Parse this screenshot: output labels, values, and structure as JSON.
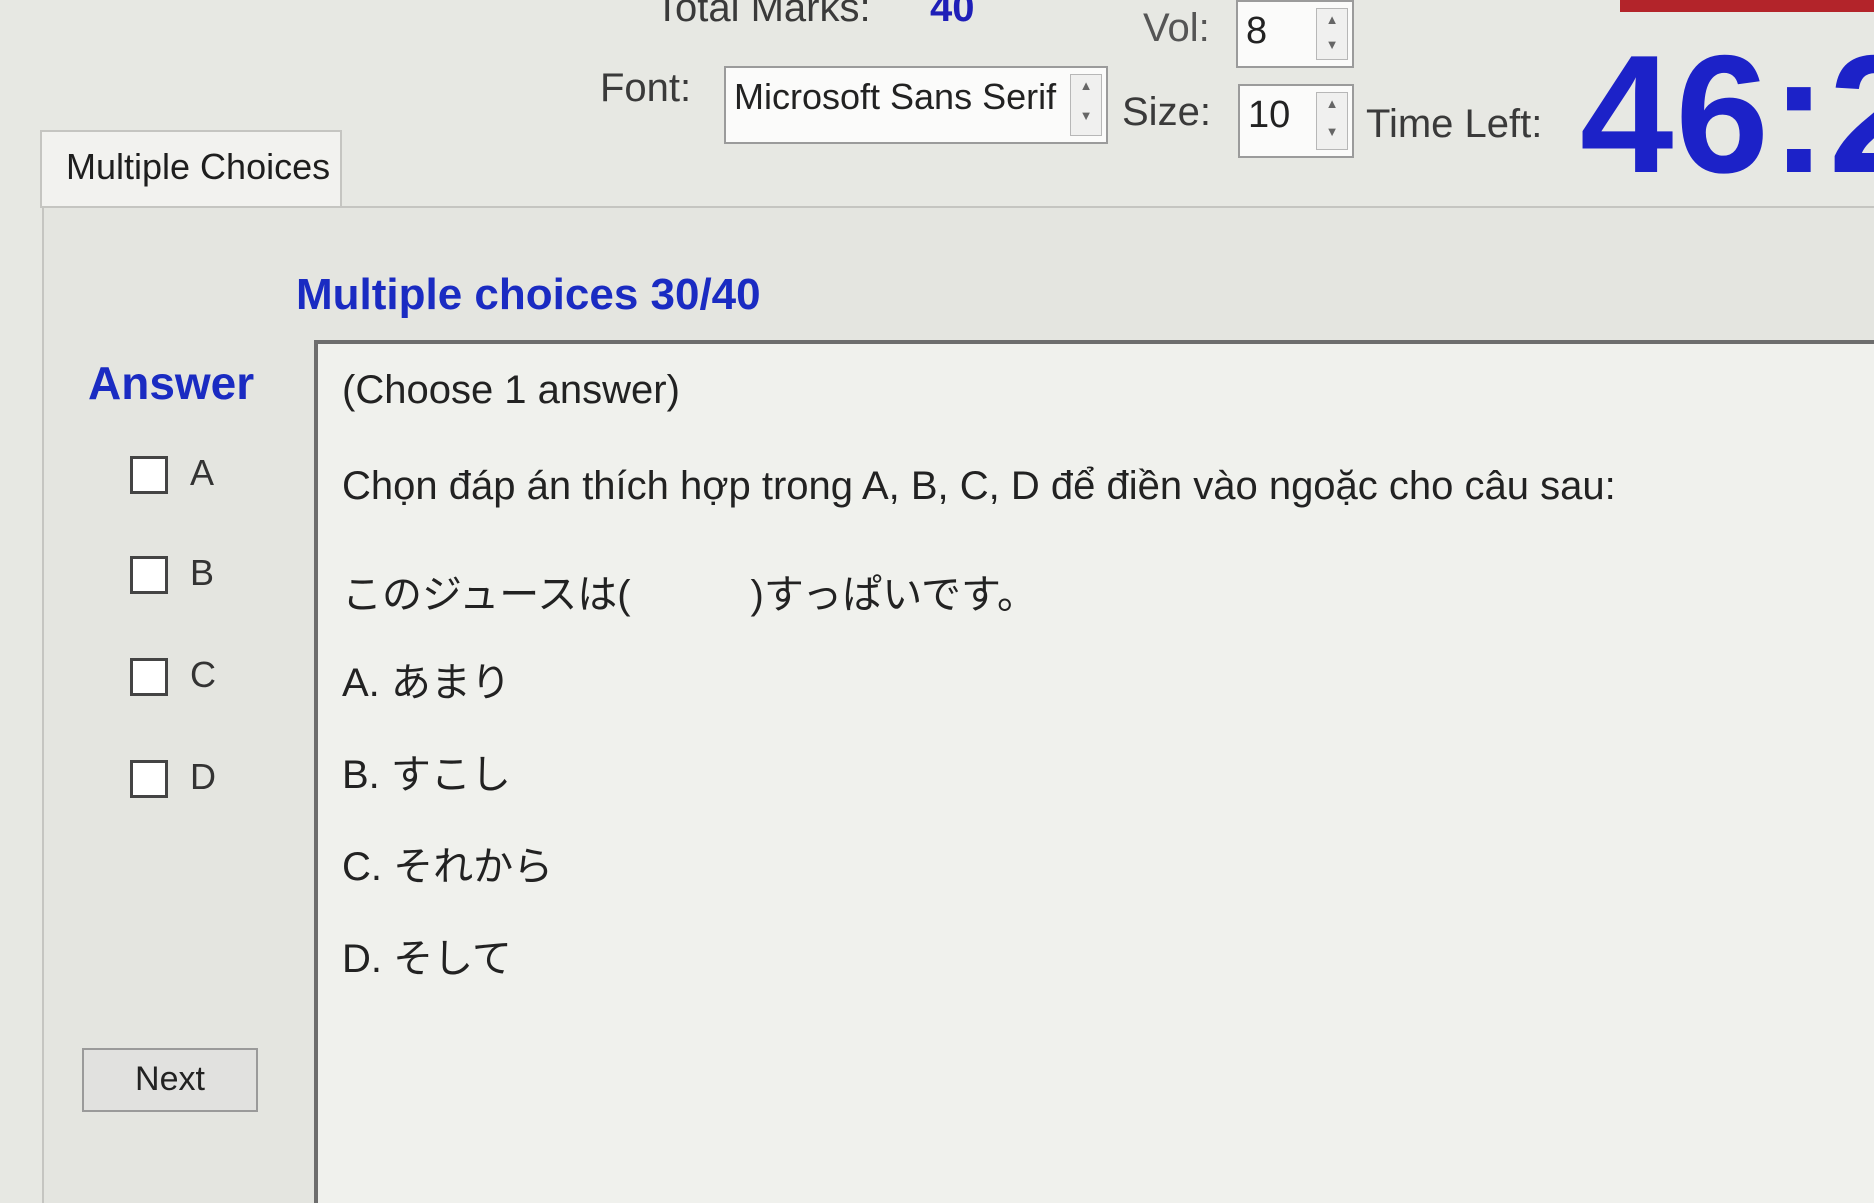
{
  "header": {
    "total_marks_label": "Total Marks:",
    "total_marks_value": "40",
    "vol_label": "Vol:",
    "vol_value": "8",
    "font_label": "Font:",
    "font_value": "Microsoft Sans Serif",
    "size_label": "Size:",
    "size_value": "10",
    "time_left_label": "Time Left:",
    "time_left_value": "46:2"
  },
  "tab": {
    "label": "Multiple Choices"
  },
  "section": {
    "title": "Multiple choices 30/40"
  },
  "answer_panel": {
    "title": "Answer",
    "choices": [
      "A",
      "B",
      "C",
      "D"
    ],
    "next_label": "Next"
  },
  "question": {
    "instruction": "(Choose 1 answer)",
    "prompt": "Chọn đáp án thích hợp trong A, B, C, D để điền vào ngoặc cho câu sau:",
    "sentence": "このジュースは(　　　)すっぱいです。",
    "options": [
      "A.  あまり",
      "B.  すこし",
      "C.  それから",
      "D.  そして"
    ]
  },
  "colors": {
    "accent_blue": "#1a2bc2",
    "timer_blue": "#1c22c8",
    "top_red": "#b3242a"
  }
}
